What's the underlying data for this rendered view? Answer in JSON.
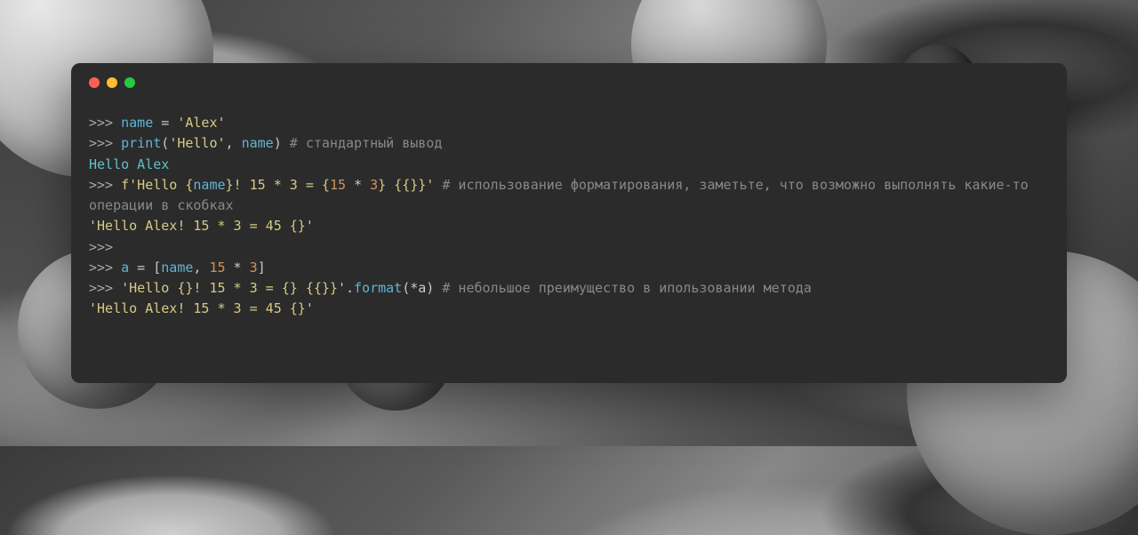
{
  "window": {
    "traffic_lights": {
      "red": "close",
      "yellow": "minimize",
      "green": "maximize"
    }
  },
  "code": {
    "line1": {
      "prompt": ">>> ",
      "var": "name",
      "assign": " = ",
      "value": "'Alex'"
    },
    "line2": {
      "prompt": ">>> ",
      "func": "print",
      "paren_open": "(",
      "arg1": "'Hello'",
      "comma": ", ",
      "arg2": "name",
      "paren_close": ") ",
      "comment": "# стандартный вывод"
    },
    "line3": {
      "output": "Hello Alex"
    },
    "line4": {
      "prompt": ">>> ",
      "fstring_start": "f'Hello {",
      "var_in": "name",
      "fstring_mid1": "}! 15 * 3 = {",
      "expr1": "15",
      "expr_op": " * ",
      "expr2": "3",
      "fstring_end": "} {{}}'",
      "space": " ",
      "comment": "# использование форматирования, заметьте, что возможно выполнять какие-то операции в скобках"
    },
    "line5": {
      "output": "'Hello Alex! 15 * 3 = 45 {}'"
    },
    "line6": {
      "prompt": ">>> "
    },
    "line7": {
      "prompt": ">>> ",
      "var": "a",
      "assign": " = [",
      "item1": "name",
      "comma": ", ",
      "item2a": "15",
      "item_op": " * ",
      "item2b": "3",
      "close": "]"
    },
    "line8": {
      "prompt": ">>> ",
      "string": "'Hello {}! 15 * 3 = {} {{}}'",
      "dot": ".",
      "method": "format",
      "args": "(*a) ",
      "comment": "# небольшое преимущество в ипользовании метода"
    },
    "line9": {
      "output": "'Hello Alex! 15 * 3 = 45 {}'"
    }
  }
}
